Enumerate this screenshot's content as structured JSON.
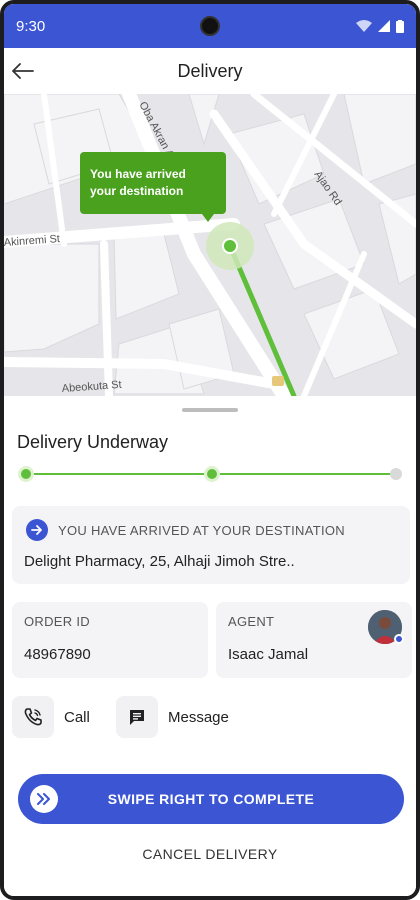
{
  "status_bar": {
    "time": "9:30"
  },
  "header": {
    "title": "Delivery"
  },
  "map": {
    "popup_line1": "You have arrived",
    "popup_line2": "your destination",
    "street_labels": [
      "Oba Akran Av",
      "Akinremi St",
      "Ajao Rd",
      "Abeokuta St"
    ],
    "route_color": "#5fbf3a"
  },
  "delivery": {
    "title": "Delivery Underway",
    "progress_stages_completed": 2,
    "progress_stages_total": 3,
    "destination_label": "YOU HAVE ARRIVED AT YOUR DESTINATION",
    "destination_address": "Delight Pharmacy, 25, Alhaji Jimoh Stre.."
  },
  "order": {
    "label": "ORDER ID",
    "value": "48967890"
  },
  "agent": {
    "label": "AGENT",
    "name": "Isaac Jamal"
  },
  "actions": {
    "call": "Call",
    "message": "Message"
  },
  "swipe": {
    "label": "SWIPE RIGHT TO COMPLETE"
  },
  "cancel": {
    "label": "CANCEL DELIVERY"
  },
  "colors": {
    "primary": "#3b55d3",
    "success": "#5fbf3a",
    "popup": "#4aa11e"
  }
}
